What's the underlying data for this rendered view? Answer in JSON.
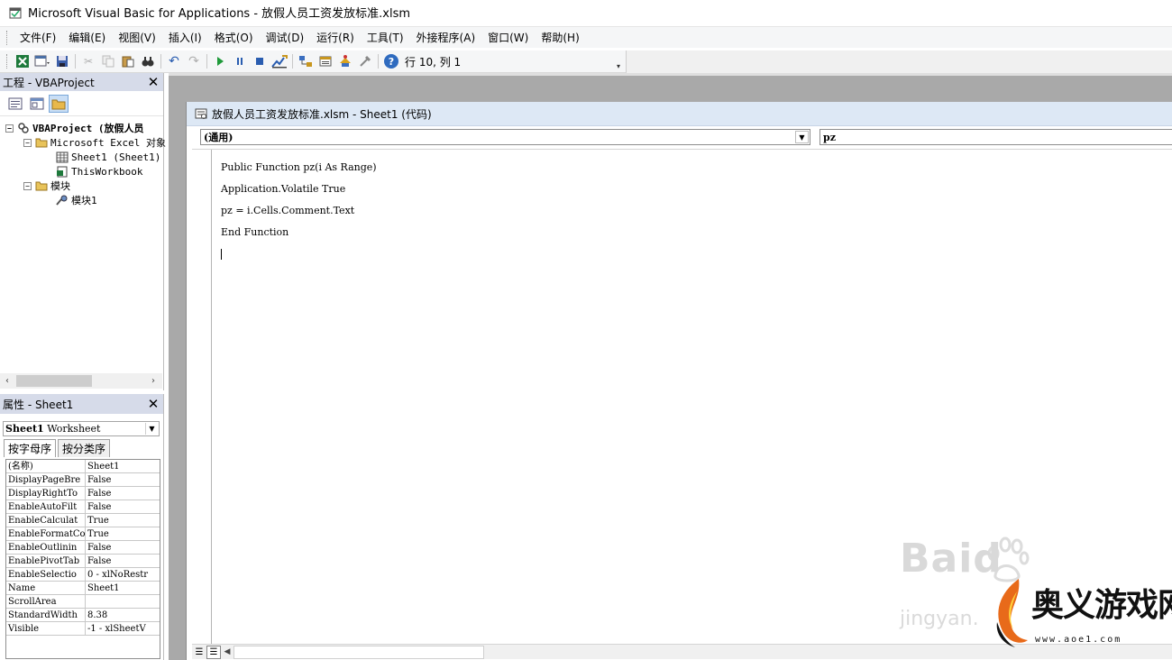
{
  "window": {
    "title": "Microsoft Visual Basic for Applications - 放假人员工资发放标准.xlsm"
  },
  "menu": {
    "items": [
      "文件(F)",
      "编辑(E)",
      "视图(V)",
      "插入(I)",
      "格式(O)",
      "调试(D)",
      "运行(R)",
      "工具(T)",
      "外接程序(A)",
      "窗口(W)",
      "帮助(H)"
    ]
  },
  "toolbar": {
    "position_text": "行 10, 列 1",
    "icons": [
      "excel-icon",
      "insert-userform-icon",
      "save-icon",
      "cut-icon",
      "copy-icon",
      "paste-icon",
      "find-icon",
      "undo-icon",
      "redo-icon",
      "run-icon",
      "break-icon",
      "reset-icon",
      "design-mode-icon",
      "project-explorer-icon",
      "properties-icon",
      "object-browser-icon",
      "toolbox-icon",
      "help-icon"
    ]
  },
  "project_explorer": {
    "title": "工程 - VBAProject",
    "tree": {
      "root": "VBAProject (放假人员",
      "folder_objects": "Microsoft Excel 对象",
      "sheet1": "Sheet1 (Sheet1)",
      "thisworkbook": "ThisWorkbook",
      "folder_modules": "模块",
      "module1": "模块1"
    }
  },
  "properties": {
    "title": "属性 - Sheet1",
    "object_name": "Sheet1",
    "object_type": "Worksheet",
    "tabs": [
      "按字母序",
      "按分类序"
    ],
    "rows": [
      {
        "name": "(名称)",
        "value": "Sheet1"
      },
      {
        "name": "DisplayPageBre",
        "value": "False"
      },
      {
        "name": "DisplayRightTo",
        "value": "False"
      },
      {
        "name": "EnableAutoFilt",
        "value": "False"
      },
      {
        "name": "EnableCalculat",
        "value": "True"
      },
      {
        "name": "EnableFormatCo",
        "value": "True"
      },
      {
        "name": "EnableOutlinin",
        "value": "False"
      },
      {
        "name": "EnablePivotTab",
        "value": "False"
      },
      {
        "name": "EnableSelectio",
        "value": "0 - xlNoRestr"
      },
      {
        "name": "Name",
        "value": "Sheet1"
      },
      {
        "name": "ScrollArea",
        "value": ""
      },
      {
        "name": "StandardWidth",
        "value": "8.38"
      },
      {
        "name": "Visible",
        "value": "-1 - xlSheetV"
      }
    ]
  },
  "code_window": {
    "title": "放假人员工资发放标准.xlsm - Sheet1 (代码)",
    "object_combo": "(通用)",
    "proc_combo": "pz",
    "lines": [
      "Public Function pz(i As Range)",
      "Application.Volatile True",
      "pz = i.Cells.Comment.Text",
      "End Function"
    ]
  },
  "watermarks": {
    "baidu": "Baid",
    "jingyan": "jingyan.",
    "brand": "奥义游戏网",
    "url": "www.aoe1.com"
  }
}
